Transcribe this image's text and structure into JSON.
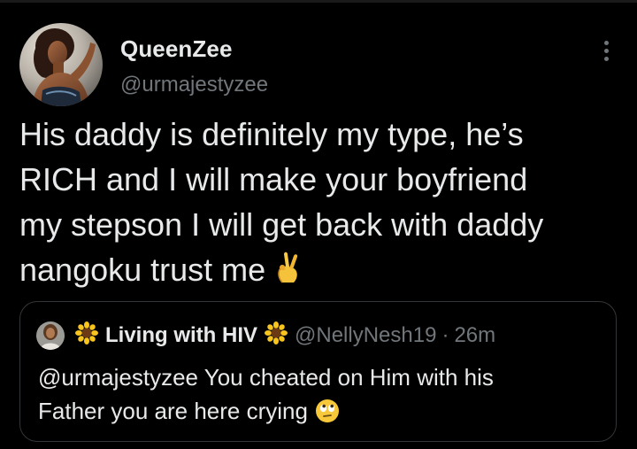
{
  "tweet": {
    "author": {
      "display_name": "QueenZee",
      "handle": "@urmajestyzee",
      "avatar_icon": "profile-photo"
    },
    "more_icon": "more-vertical-icon",
    "text_lines": [
      "His daddy is definitely my type, he’s",
      "RICH and I will make your boyfriend",
      "my stepson I will get back with daddy",
      "nangoku trust me"
    ],
    "text_emoji": "crossed-fingers-icon"
  },
  "quoted_tweet": {
    "author": {
      "display_name": "Living with HIV",
      "handle": "@NellyNesh19",
      "name_emoji": "sunflower-icon"
    },
    "separator": "·",
    "time": "26m",
    "text_lines": [
      "@urmajestyzee You cheated on Him with his",
      "Father you are here crying"
    ],
    "text_emoji": "face-with-rolling-eyes-icon"
  },
  "colors": {
    "background": "#000000",
    "primary_text": "#e7e9ea",
    "secondary_text": "#71767b",
    "border": "#333639"
  }
}
